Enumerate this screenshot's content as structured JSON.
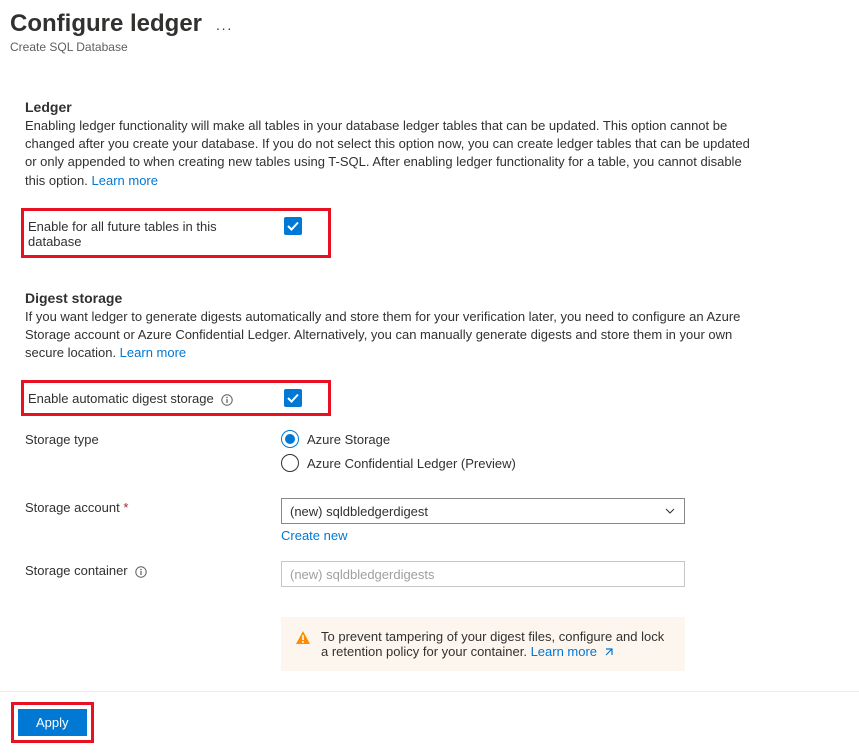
{
  "header": {
    "title": "Configure ledger",
    "subtitle": "Create SQL Database"
  },
  "ledger": {
    "heading": "Ledger",
    "description": "Enabling ledger functionality will make all tables in your database ledger tables that can be updated. This option cannot be changed after you create your database. If you do not select this option now, you can create ledger tables that can be updated or only appended to when creating new tables using T-SQL. After enabling ledger functionality for a table, you cannot disable this option. ",
    "learn_more": "Learn more",
    "enable_label": "Enable for all future tables in this database"
  },
  "digest": {
    "heading": "Digest storage",
    "description": "If you want ledger to generate digests automatically and store them for your verification later, you need to configure an Azure Storage account or Azure Confidential Ledger. Alternatively, you can manually generate digests and store them in your own secure location. ",
    "learn_more": "Learn more",
    "enable_label": "Enable automatic digest storage",
    "storage_type_label": "Storage type",
    "storage_type_options": {
      "azure_storage": "Azure Storage",
      "confidential": "Azure Confidential Ledger (Preview)"
    },
    "storage_account_label": "Storage account",
    "storage_account_value": "(new) sqldbledgerdigest",
    "create_new": "Create new",
    "storage_container_label": "Storage container",
    "storage_container_placeholder": "(new) sqldbledgerdigests"
  },
  "warning": {
    "text": "To prevent tampering of your digest files, configure and lock a retention policy for your container. ",
    "learn_more": "Learn more"
  },
  "footer": {
    "apply": "Apply"
  }
}
